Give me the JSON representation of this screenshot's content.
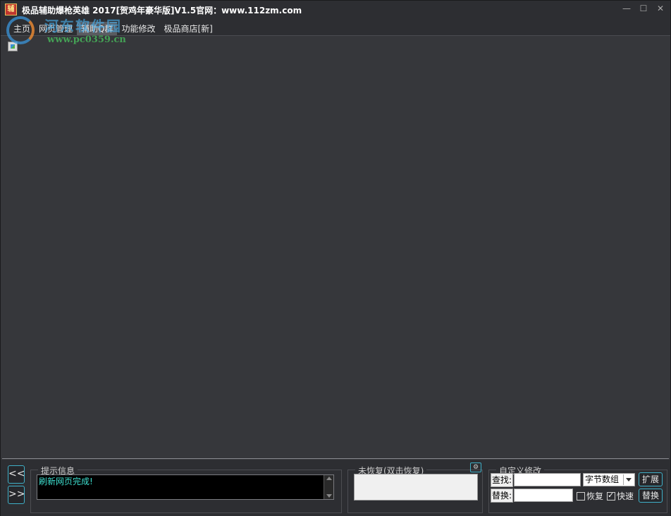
{
  "titlebar": {
    "app_icon_text": "辅",
    "title": "极品辅助爆枪英雄 2017[贺鸡年豪华版]V1.5官网：www.112zm.com",
    "minimize": "—",
    "maximize": "☐",
    "close": "✕"
  },
  "menu": {
    "items": [
      {
        "label": "主页"
      },
      {
        "label": "网页管理"
      },
      {
        "label": "辅助Q群"
      },
      {
        "label": "功能修改"
      },
      {
        "label": "极品商店[新]"
      }
    ]
  },
  "watermark": {
    "text": "河东软件园",
    "url": "www.pc0359.cn"
  },
  "bottom": {
    "prev_btn": "<<",
    "next_btn": ">>",
    "info_group_label": "提示信息",
    "info_text": "刷新网页完成!",
    "restore_group_label": "未恢复(双击恢复)",
    "gear_btn": "⚙",
    "custom_group_label": "自定义修改",
    "find_label": "查找:",
    "find_value": "",
    "replace_label": "替换:",
    "replace_value": "",
    "type_select": "字节数组",
    "expand_btn": "扩展",
    "replace_btn": "替换",
    "restore_check_label": "恢复",
    "restore_checked": false,
    "fast_check_label": "快速",
    "fast_checked": true
  },
  "icons": {
    "broken_image": "broken-image-icon"
  }
}
